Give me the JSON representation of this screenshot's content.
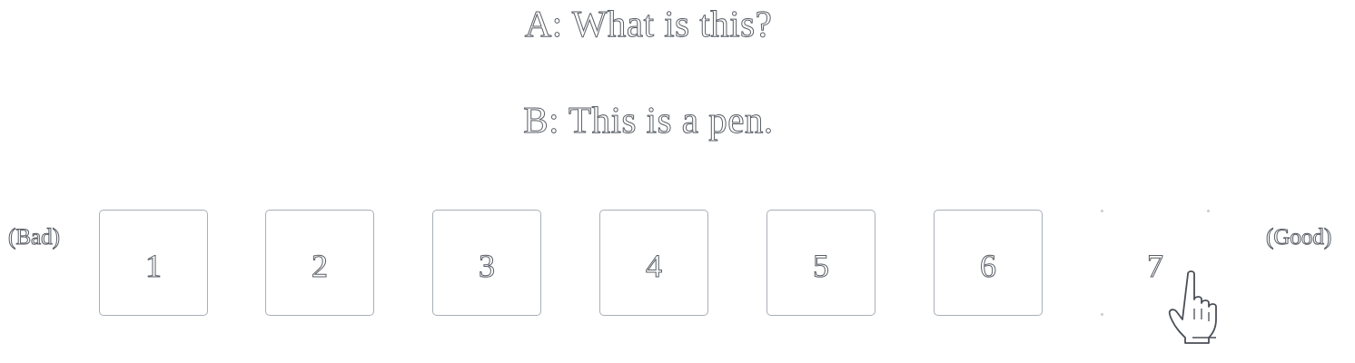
{
  "dialogue": {
    "line_a": "A: What is this?",
    "line_b": "B: This is a pen."
  },
  "scale": {
    "min_label": "(Bad)",
    "max_label": "(Good)",
    "options": [
      "1",
      "2",
      "3",
      "4",
      "5",
      "6",
      "7"
    ],
    "hovered_option": "7"
  },
  "cursor": {
    "icon": "hand-pointer-icon"
  },
  "colors": {
    "text_outline": "#5a5f66",
    "box_border": "#a9afb8",
    "background": "#ffffff"
  }
}
